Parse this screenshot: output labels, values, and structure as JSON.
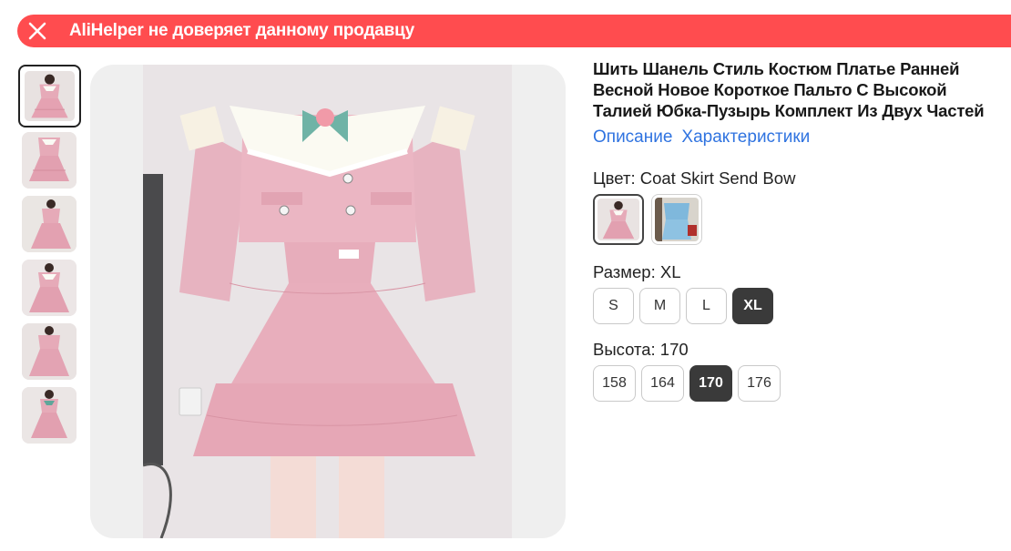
{
  "banner": {
    "text": "AliHelper не доверяет данному продавцу",
    "color": "#ff4c4f",
    "close_icon": "close-icon"
  },
  "gallery": {
    "thumbnail_count": 6,
    "active_index": 0
  },
  "product": {
    "title": "Шить Шанель Стиль Костюм Платье Ранней Весной Новое Короткое Пальто С Высокой Талией Юбка-Пузырь Комплект Из Двух Частей",
    "tabs": [
      "Описание",
      "Характеристики"
    ],
    "link_color": "#2f73e0"
  },
  "color": {
    "label": "Цвет: Coat Skirt Send Bow",
    "options": [
      "pink-dress",
      "blue-dress"
    ],
    "selected_index": 0
  },
  "size": {
    "label": "Размер: XL",
    "options": [
      "S",
      "M",
      "L",
      "XL"
    ],
    "selected_index": 3
  },
  "height": {
    "label": "Высота: 170",
    "options": [
      "158",
      "164",
      "170",
      "176"
    ],
    "selected_index": 2
  }
}
